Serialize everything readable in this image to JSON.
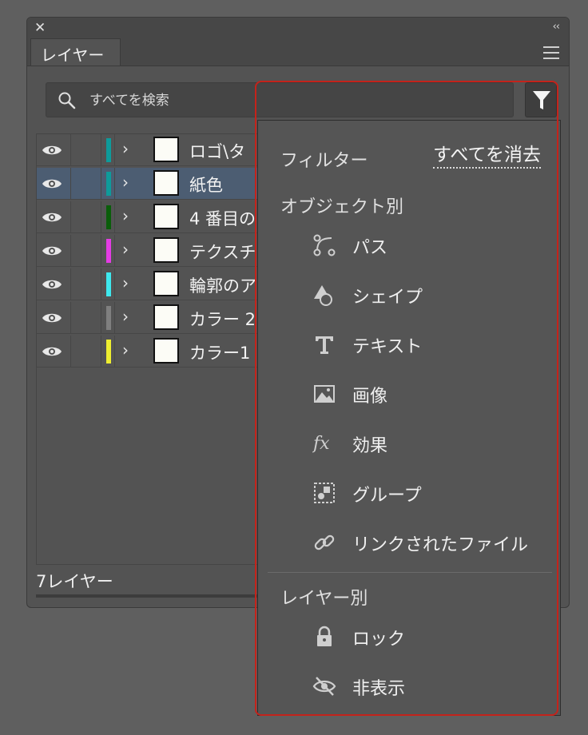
{
  "panel": {
    "close_glyph": "✕",
    "collapse_glyph": "‹‹",
    "tab_label": "レイヤー"
  },
  "search": {
    "placeholder": "すべてを検索"
  },
  "layers": [
    {
      "name": "ロゴ\\タ",
      "color": "#0e9b9b",
      "selected": false
    },
    {
      "name": "紙色",
      "color": "#0e9b9b",
      "selected": true
    },
    {
      "name": "4 番目の",
      "color": "#0a5e0a",
      "selected": false
    },
    {
      "name": "テクスチ",
      "color": "#e43ce4",
      "selected": false
    },
    {
      "name": "輪郭のア",
      "color": "#3ee8ee",
      "selected": false
    },
    {
      "name": "カラー 2",
      "color": "#7f7f7f",
      "selected": false
    },
    {
      "name": "カラー1",
      "color": "#eeee30",
      "selected": false
    }
  ],
  "footer": {
    "layer_count": "7レイヤー"
  },
  "filter_menu": {
    "title": "フィルター",
    "clear_all": "すべてを消去",
    "by_object_label": "オブジェクト別",
    "by_object_items": [
      {
        "label": "パス",
        "icon": "path-icon"
      },
      {
        "label": "シェイプ",
        "icon": "shape-icon"
      },
      {
        "label": "テキスト",
        "icon": "text-icon"
      },
      {
        "label": "画像",
        "icon": "image-icon"
      },
      {
        "label": "効果",
        "icon": "effect-icon"
      },
      {
        "label": "グループ",
        "icon": "group-icon"
      },
      {
        "label": "リンクされたファイル",
        "icon": "link-icon"
      }
    ],
    "by_layer_label": "レイヤー別",
    "by_layer_items": [
      {
        "label": "ロック",
        "icon": "lock-icon"
      },
      {
        "label": "非表示",
        "icon": "hidden-eye-icon"
      }
    ]
  },
  "colors": {
    "highlight": "#c4231b",
    "selected_row": "#4c5d72"
  }
}
